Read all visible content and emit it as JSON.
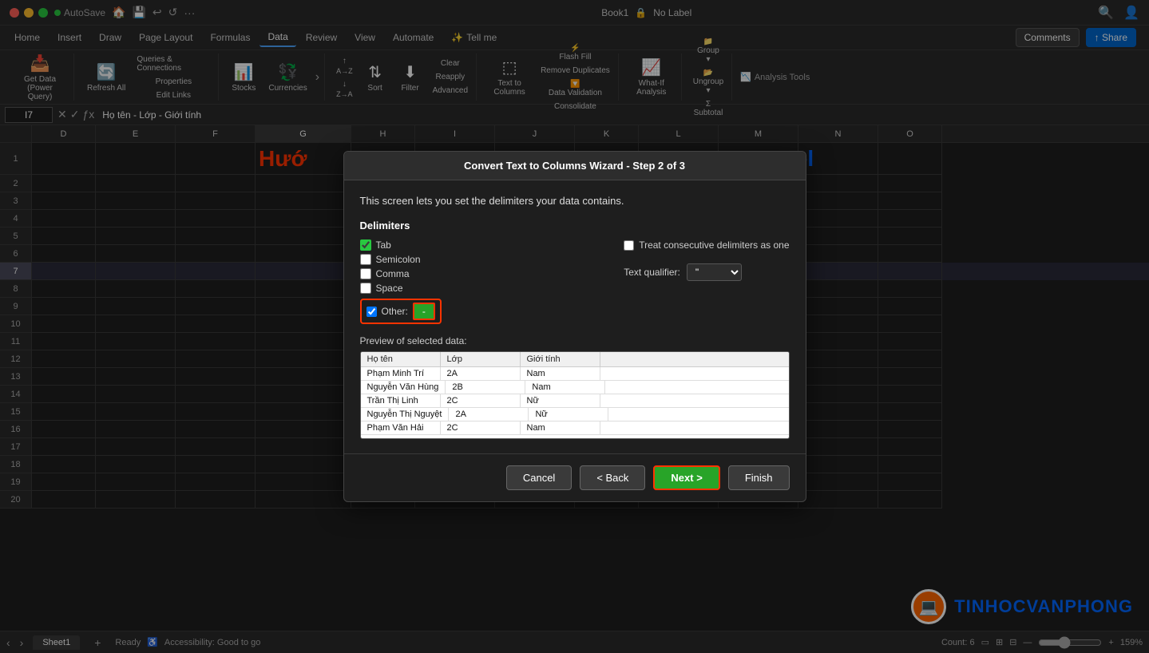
{
  "titlebar": {
    "autosave": "AutoSave",
    "filename": "Book1",
    "no_label": "No Label",
    "search_icon": "🔍",
    "person_icon": "👤"
  },
  "ribbon": {
    "tabs": [
      "Home",
      "Insert",
      "Draw",
      "Page Layout",
      "Formulas",
      "Data",
      "Review",
      "View",
      "Automate",
      "Tell me"
    ],
    "active_tab": "Data",
    "groups": {
      "get_data": {
        "label": "Get Data (Power Query)"
      },
      "refresh": {
        "label": "Refresh All"
      },
      "queries": {
        "label": "Queries & Connections"
      },
      "properties": {
        "label": "Properties"
      },
      "edit_links": {
        "label": "Edit Links"
      },
      "stocks": {
        "label": "Stocks"
      },
      "currencies": {
        "label": "Currencies"
      },
      "sort_az": "A→Z",
      "sort_za": "Z→A",
      "sort": "Sort",
      "filter": "Filter",
      "clear": "Clear",
      "reapply": "Reapply",
      "advanced": "Advanced",
      "text_to_columns": "Text to Columns",
      "flash_fill": "Flash Fill",
      "remove_duplicates": "Remove Duplicates",
      "data_validation": "Data Validation",
      "consolidate": "Consolidate",
      "what_if": "What-If Analysis",
      "group": "Group",
      "ungroup": "Ungroup",
      "subtotal": "Subtotal",
      "analysis_tools": "Analysis Tools"
    },
    "comments_label": "Comments",
    "share_label": "Share"
  },
  "formula_bar": {
    "cell_ref": "I7",
    "formula": "Họ tên - Lớp - Giới tính"
  },
  "columns": [
    "D",
    "E",
    "F",
    "G",
    "H",
    "I",
    "J",
    "K",
    "L",
    "M",
    "N",
    "O"
  ],
  "rows": [
    1,
    2,
    3,
    4,
    5,
    6,
    7,
    8,
    9,
    10,
    11,
    12,
    13,
    14,
    15,
    16,
    17,
    18,
    19,
    20
  ],
  "spreadsheet": {
    "title1": "Hướ",
    "title2": "ng Excel",
    "title_row": 1,
    "title_col": "G"
  },
  "dialog": {
    "title": "Convert Text to Columns Wizard - Step 2 of 3",
    "subtitle": "This screen lets you set the delimiters your data contains.",
    "delimiters_label": "Delimiters",
    "tab_label": "Tab",
    "tab_checked": true,
    "semicolon_label": "Semicolon",
    "semicolon_checked": false,
    "comma_label": "Comma",
    "comma_checked": false,
    "space_label": "Space",
    "space_checked": false,
    "other_label": "Other:",
    "other_checked": true,
    "other_value": "-",
    "treat_consecutive_label": "Treat consecutive delimiters as one",
    "treat_consecutive_checked": false,
    "text_qualifier_label": "Text qualifier:",
    "text_qualifier_value": "\"",
    "preview_label": "Preview of selected data:",
    "preview_headers": [
      "Họ tên",
      "Lớp",
      "Giới tính"
    ],
    "preview_rows": [
      [
        "Phạm Minh Trí",
        "2A",
        "Nam"
      ],
      [
        "Nguyễn Văn Hùng",
        "2B",
        "Nam"
      ],
      [
        "Trần Thị Linh",
        "2C",
        "Nữ"
      ],
      [
        "Nguyễn Thị Nguyệt",
        "2A",
        "Nữ"
      ],
      [
        "Phạm Văn Hải",
        "2C",
        "Nam"
      ]
    ],
    "cancel_label": "Cancel",
    "back_label": "< Back",
    "next_label": "Next >",
    "finish_label": "Finish"
  },
  "status_bar": {
    "ready": "Ready",
    "accessibility": "Accessibility: Good to go",
    "count": "Count: 6",
    "zoom": "159%",
    "sheet_tab": "Sheet1"
  },
  "watermark": {
    "logo": "💻",
    "text": "TINHOCVANPHONG"
  }
}
